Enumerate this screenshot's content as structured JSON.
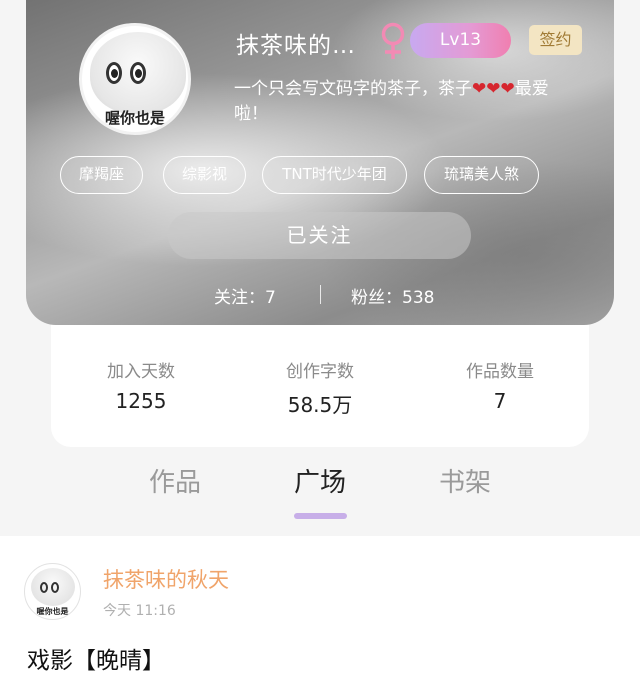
{
  "profile": {
    "username": "抹茶味的…",
    "gender_icon": "female-symbol-icon",
    "level": "Lv13",
    "sign_badge": "签约",
    "bio_part1": "一个只会写文码字的茶子，茶子",
    "bio_hearts": "❤❤❤",
    "bio_part2": "最爱",
    "bio_line2": "啦！",
    "avatar_caption": "喔你也是",
    "tags": [
      "摩羯座",
      "综影视",
      "TNT时代少年团",
      "琉璃美人煞"
    ],
    "follow_button": "已关注",
    "following": "关注：7",
    "fans": "粉丝：538"
  },
  "stats": [
    {
      "label": "加入天数",
      "value": "1255"
    },
    {
      "label": "创作字数",
      "value": "58.5万"
    },
    {
      "label": "作品数量",
      "value": "7"
    }
  ],
  "tabs": [
    {
      "label": "作品",
      "active": false
    },
    {
      "label": "广场",
      "active": true
    },
    {
      "label": "书架",
      "active": false
    }
  ],
  "post": {
    "author": "抹茶味的秋天",
    "time": "今天 11:16",
    "title": "戏影【晚晴】",
    "avatar_caption": "喔你也是"
  },
  "colors": {
    "level_gradient_start": "#c8a9f0",
    "level_gradient_end": "#f07fb0",
    "gender": "#f28ab4",
    "sign_badge_bg": "#f3e5c3",
    "author_name": "#f0a46a",
    "tab_indicator": "#c7aee8"
  }
}
